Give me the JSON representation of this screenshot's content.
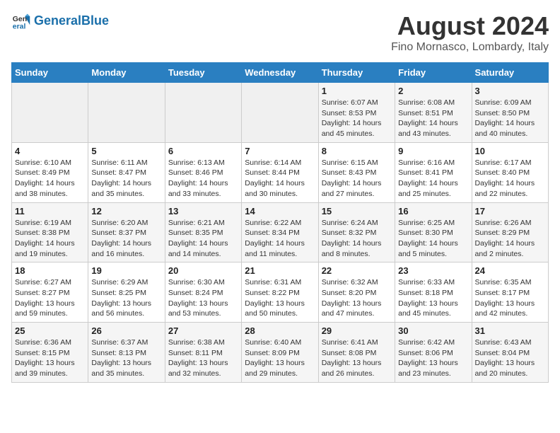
{
  "logo": {
    "text_general": "General",
    "text_blue": "Blue"
  },
  "header": {
    "title": "August 2024",
    "subtitle": "Fino Mornasco, Lombardy, Italy"
  },
  "weekdays": [
    "Sunday",
    "Monday",
    "Tuesday",
    "Wednesday",
    "Thursday",
    "Friday",
    "Saturday"
  ],
  "weeks": [
    [
      {
        "day": "",
        "info": ""
      },
      {
        "day": "",
        "info": ""
      },
      {
        "day": "",
        "info": ""
      },
      {
        "day": "",
        "info": ""
      },
      {
        "day": "1",
        "info": "Sunrise: 6:07 AM\nSunset: 8:53 PM\nDaylight: 14 hours\nand 45 minutes."
      },
      {
        "day": "2",
        "info": "Sunrise: 6:08 AM\nSunset: 8:51 PM\nDaylight: 14 hours\nand 43 minutes."
      },
      {
        "day": "3",
        "info": "Sunrise: 6:09 AM\nSunset: 8:50 PM\nDaylight: 14 hours\nand 40 minutes."
      }
    ],
    [
      {
        "day": "4",
        "info": "Sunrise: 6:10 AM\nSunset: 8:49 PM\nDaylight: 14 hours\nand 38 minutes."
      },
      {
        "day": "5",
        "info": "Sunrise: 6:11 AM\nSunset: 8:47 PM\nDaylight: 14 hours\nand 35 minutes."
      },
      {
        "day": "6",
        "info": "Sunrise: 6:13 AM\nSunset: 8:46 PM\nDaylight: 14 hours\nand 33 minutes."
      },
      {
        "day": "7",
        "info": "Sunrise: 6:14 AM\nSunset: 8:44 PM\nDaylight: 14 hours\nand 30 minutes."
      },
      {
        "day": "8",
        "info": "Sunrise: 6:15 AM\nSunset: 8:43 PM\nDaylight: 14 hours\nand 27 minutes."
      },
      {
        "day": "9",
        "info": "Sunrise: 6:16 AM\nSunset: 8:41 PM\nDaylight: 14 hours\nand 25 minutes."
      },
      {
        "day": "10",
        "info": "Sunrise: 6:17 AM\nSunset: 8:40 PM\nDaylight: 14 hours\nand 22 minutes."
      }
    ],
    [
      {
        "day": "11",
        "info": "Sunrise: 6:19 AM\nSunset: 8:38 PM\nDaylight: 14 hours\nand 19 minutes."
      },
      {
        "day": "12",
        "info": "Sunrise: 6:20 AM\nSunset: 8:37 PM\nDaylight: 14 hours\nand 16 minutes."
      },
      {
        "day": "13",
        "info": "Sunrise: 6:21 AM\nSunset: 8:35 PM\nDaylight: 14 hours\nand 14 minutes."
      },
      {
        "day": "14",
        "info": "Sunrise: 6:22 AM\nSunset: 8:34 PM\nDaylight: 14 hours\nand 11 minutes."
      },
      {
        "day": "15",
        "info": "Sunrise: 6:24 AM\nSunset: 8:32 PM\nDaylight: 14 hours\nand 8 minutes."
      },
      {
        "day": "16",
        "info": "Sunrise: 6:25 AM\nSunset: 8:30 PM\nDaylight: 14 hours\nand 5 minutes."
      },
      {
        "day": "17",
        "info": "Sunrise: 6:26 AM\nSunset: 8:29 PM\nDaylight: 14 hours\nand 2 minutes."
      }
    ],
    [
      {
        "day": "18",
        "info": "Sunrise: 6:27 AM\nSunset: 8:27 PM\nDaylight: 13 hours\nand 59 minutes."
      },
      {
        "day": "19",
        "info": "Sunrise: 6:29 AM\nSunset: 8:25 PM\nDaylight: 13 hours\nand 56 minutes."
      },
      {
        "day": "20",
        "info": "Sunrise: 6:30 AM\nSunset: 8:24 PM\nDaylight: 13 hours\nand 53 minutes."
      },
      {
        "day": "21",
        "info": "Sunrise: 6:31 AM\nSunset: 8:22 PM\nDaylight: 13 hours\nand 50 minutes."
      },
      {
        "day": "22",
        "info": "Sunrise: 6:32 AM\nSunset: 8:20 PM\nDaylight: 13 hours\nand 47 minutes."
      },
      {
        "day": "23",
        "info": "Sunrise: 6:33 AM\nSunset: 8:18 PM\nDaylight: 13 hours\nand 45 minutes."
      },
      {
        "day": "24",
        "info": "Sunrise: 6:35 AM\nSunset: 8:17 PM\nDaylight: 13 hours\nand 42 minutes."
      }
    ],
    [
      {
        "day": "25",
        "info": "Sunrise: 6:36 AM\nSunset: 8:15 PM\nDaylight: 13 hours\nand 39 minutes."
      },
      {
        "day": "26",
        "info": "Sunrise: 6:37 AM\nSunset: 8:13 PM\nDaylight: 13 hours\nand 35 minutes."
      },
      {
        "day": "27",
        "info": "Sunrise: 6:38 AM\nSunset: 8:11 PM\nDaylight: 13 hours\nand 32 minutes."
      },
      {
        "day": "28",
        "info": "Sunrise: 6:40 AM\nSunset: 8:09 PM\nDaylight: 13 hours\nand 29 minutes."
      },
      {
        "day": "29",
        "info": "Sunrise: 6:41 AM\nSunset: 8:08 PM\nDaylight: 13 hours\nand 26 minutes."
      },
      {
        "day": "30",
        "info": "Sunrise: 6:42 AM\nSunset: 8:06 PM\nDaylight: 13 hours\nand 23 minutes."
      },
      {
        "day": "31",
        "info": "Sunrise: 6:43 AM\nSunset: 8:04 PM\nDaylight: 13 hours\nand 20 minutes."
      }
    ]
  ]
}
